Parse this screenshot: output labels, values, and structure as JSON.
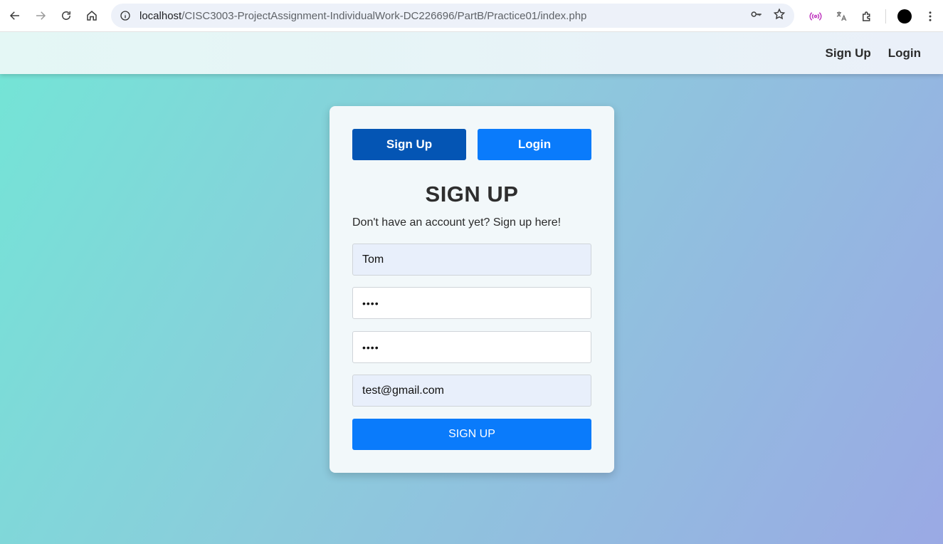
{
  "browser": {
    "url_host": "localhost",
    "url_path": "/CISC3003-ProjectAssignment-IndividualWork-DC226696/PartB/Practice01/index.php",
    "icons": [
      "back-icon",
      "forward-icon",
      "reload-icon",
      "home-icon",
      "info-icon",
      "key-icon",
      "star-icon",
      "broadcast-icon",
      "translate-icon",
      "extensions-icon",
      "profile-icon",
      "menu-icon"
    ]
  },
  "header": {
    "signup_link": "Sign Up",
    "login_link": "Login"
  },
  "card": {
    "tab_signup": "Sign Up",
    "tab_login": "Login",
    "title": "SIGN UP",
    "subtitle": "Don't have an account yet? Sign up here!",
    "fields": {
      "username": "Tom",
      "password": "••••",
      "confirm_password": "••••",
      "email": "test@gmail.com"
    },
    "submit_label": "SIGN UP"
  },
  "colors": {
    "tab_signup_bg": "#0455b4",
    "tab_login_bg": "#0a7bfb",
    "submit_bg": "#0a7bfb"
  }
}
